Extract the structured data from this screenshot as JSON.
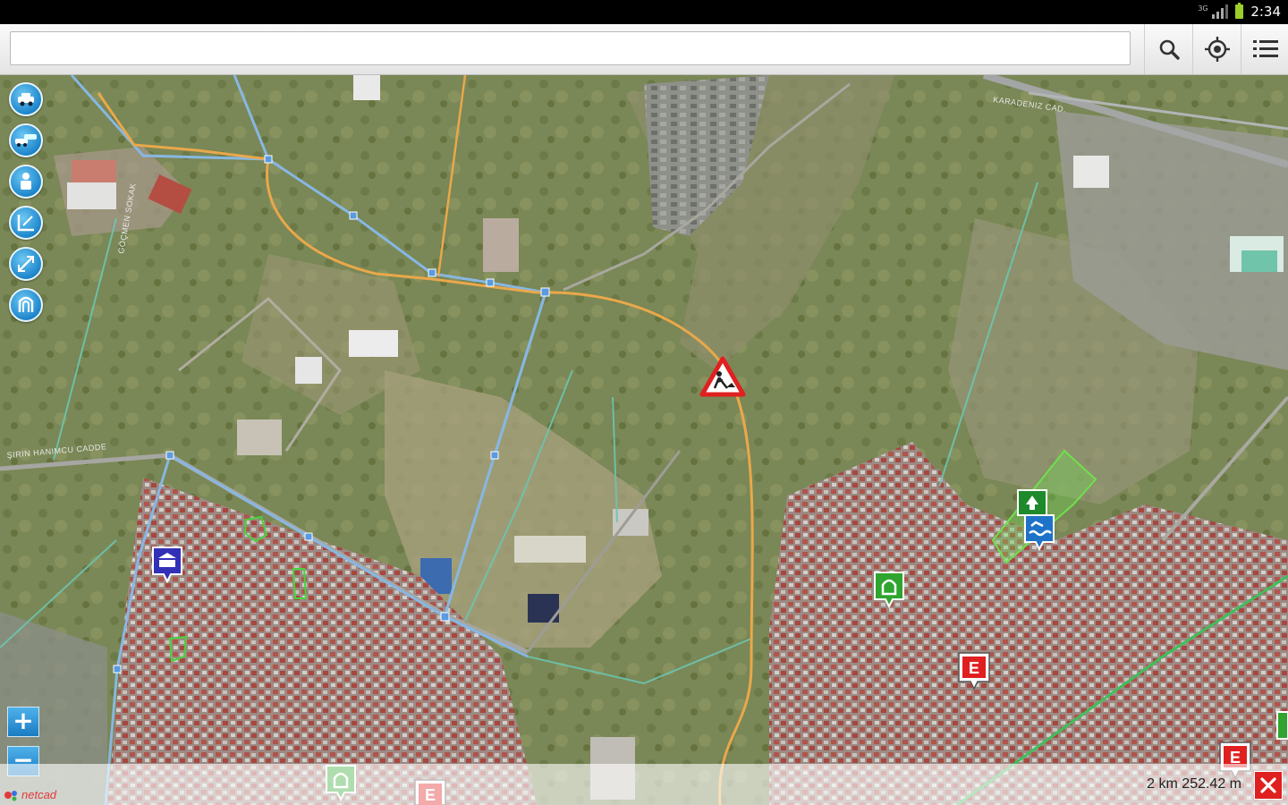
{
  "status_bar": {
    "time": "2:34",
    "network_label": "3G"
  },
  "toolbar": {
    "search_value": "",
    "search_placeholder": "",
    "search_icon": "search-icon",
    "locate_icon": "crosshair-icon",
    "menu_icon": "menu-icon"
  },
  "map": {
    "street_labels": [
      "ŞIRIN HANIMCU CADDE",
      "KARADENIZ CAD.",
      "GÖÇMEN SOKAK"
    ],
    "left_tools": [
      "vehicle-icon",
      "multi-vehicle-icon",
      "person-icon",
      "measure-line-icon",
      "measure-distance-icon",
      "measure-area-icon"
    ],
    "zoom_in": "+",
    "zoom_out": "−",
    "poi_markers": [
      {
        "type": "roadwork-warning",
        "color": "#e02020"
      },
      {
        "type": "school",
        "label": "E",
        "color": "#e02020"
      },
      {
        "type": "mosque",
        "color": "#2fa52f"
      },
      {
        "type": "park",
        "color": "#2fa52f"
      },
      {
        "type": "swimming-pool",
        "color": "#1e73c8"
      },
      {
        "type": "public-building",
        "color": "#3330b8"
      }
    ]
  },
  "footer": {
    "logo_text": "netcad",
    "scale_text": "2 km 252.42 m",
    "close_icon": "close-icon"
  }
}
